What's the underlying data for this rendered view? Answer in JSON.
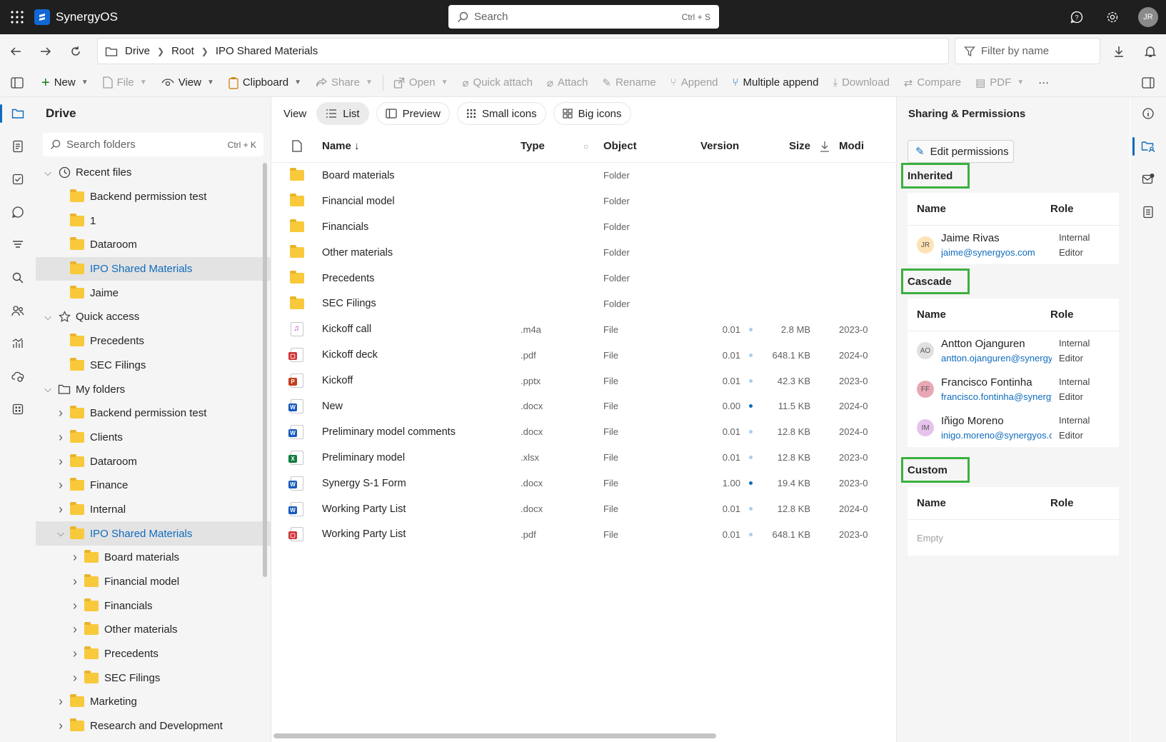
{
  "app": {
    "name": "SynergyOS",
    "user_initials": "JR"
  },
  "search": {
    "placeholder": "Search",
    "shortcut": "Ctrl + S"
  },
  "breadcrumb": [
    "Drive",
    "Root",
    "IPO Shared Materials"
  ],
  "filter": {
    "placeholder": "Filter by name"
  },
  "toolbar": {
    "new": "New",
    "file": "File",
    "view": "View",
    "clipboard": "Clipboard",
    "share": "Share",
    "open": "Open",
    "quick_attach": "Quick attach",
    "attach": "Attach",
    "rename": "Rename",
    "append": "Append",
    "multiple_append": "Multiple append",
    "download": "Download",
    "compare": "Compare",
    "pdf": "PDF",
    "more": "···"
  },
  "sidebar": {
    "title": "Drive",
    "search_placeholder": "Search folders",
    "search_shortcut": "Ctrl + K",
    "tree": [
      {
        "label": "Recent files",
        "level": 0,
        "kind": "clock",
        "expanded": true
      },
      {
        "label": "Backend permission test",
        "level": 1,
        "kind": "folder"
      },
      {
        "label": "1",
        "level": 1,
        "kind": "folder"
      },
      {
        "label": "Dataroom",
        "level": 1,
        "kind": "folder"
      },
      {
        "label": "IPO Shared Materials",
        "level": 1,
        "kind": "folder",
        "selected": true
      },
      {
        "label": "Jaime",
        "level": 1,
        "kind": "folder"
      },
      {
        "label": "Quick access",
        "level": 0,
        "kind": "star",
        "expanded": true
      },
      {
        "label": "Precedents",
        "level": 1,
        "kind": "folder"
      },
      {
        "label": "SEC Filings",
        "level": 1,
        "kind": "folder"
      },
      {
        "label": "My folders",
        "level": 0,
        "kind": "outline",
        "expanded": true
      },
      {
        "label": "Backend permission test",
        "level": 1,
        "kind": "folder",
        "chevron": "right"
      },
      {
        "label": "Clients",
        "level": 1,
        "kind": "folder",
        "chevron": "right"
      },
      {
        "label": "Dataroom",
        "level": 1,
        "kind": "folder",
        "chevron": "right"
      },
      {
        "label": "Finance",
        "level": 1,
        "kind": "folder",
        "chevron": "right"
      },
      {
        "label": "Internal",
        "level": 1,
        "kind": "folder",
        "chevron": "right"
      },
      {
        "label": "IPO Shared Materials",
        "level": 1,
        "kind": "folder",
        "chevron": "down",
        "selected": true
      },
      {
        "label": "Board materials",
        "level": 2,
        "kind": "folder",
        "chevron": "right"
      },
      {
        "label": "Financial model",
        "level": 2,
        "kind": "folder",
        "chevron": "right"
      },
      {
        "label": "Financials",
        "level": 2,
        "kind": "folder",
        "chevron": "right"
      },
      {
        "label": "Other materials",
        "level": 2,
        "kind": "folder",
        "chevron": "right"
      },
      {
        "label": "Precedents",
        "level": 2,
        "kind": "folder",
        "chevron": "right"
      },
      {
        "label": "SEC Filings",
        "level": 2,
        "kind": "folder",
        "chevron": "right"
      },
      {
        "label": "Marketing",
        "level": 1,
        "kind": "folder",
        "chevron": "right"
      },
      {
        "label": "Research and Development",
        "level": 1,
        "kind": "folder",
        "chevron": "right"
      }
    ]
  },
  "viewbar": {
    "label": "View",
    "list": "List",
    "preview": "Preview",
    "small_icons": "Small icons",
    "big_icons": "Big icons"
  },
  "table": {
    "headers": {
      "name": "Name ↓",
      "type": "Type",
      "object": "Object",
      "version": "Version",
      "size": "Size",
      "modified": "Modi"
    },
    "rows": [
      {
        "icon": "folder",
        "name": "Board materials",
        "type": "",
        "object": "Folder",
        "version": "",
        "size": "",
        "modified": ""
      },
      {
        "icon": "folder",
        "name": "Financial model",
        "type": "",
        "object": "Folder",
        "version": "",
        "size": "",
        "modified": ""
      },
      {
        "icon": "folder",
        "name": "Financials",
        "type": "",
        "object": "Folder",
        "version": "",
        "size": "",
        "modified": ""
      },
      {
        "icon": "folder",
        "name": "Other materials",
        "type": "",
        "object": "Folder",
        "version": "",
        "size": "",
        "modified": ""
      },
      {
        "icon": "folder",
        "name": "Precedents",
        "type": "",
        "object": "Folder",
        "version": "",
        "size": "",
        "modified": ""
      },
      {
        "icon": "folder",
        "name": "SEC Filings",
        "type": "",
        "object": "Folder",
        "version": "",
        "size": "",
        "modified": ""
      },
      {
        "icon": "audio",
        "name": "Kickoff call",
        "type": ".m4a",
        "object": "File",
        "version": "0.01",
        "dot": "light",
        "size": "2.8 MB",
        "modified": "2023-0"
      },
      {
        "icon": "pdf",
        "name": "Kickoff deck",
        "type": ".pdf",
        "object": "File",
        "version": "0.01",
        "dot": "light",
        "size": "648.1 KB",
        "modified": "2024-0"
      },
      {
        "icon": "pptx",
        "name": "Kickoff",
        "type": ".pptx",
        "object": "File",
        "version": "0.01",
        "dot": "light",
        "size": "42.3 KB",
        "modified": "2023-0"
      },
      {
        "icon": "docx",
        "name": "New",
        "type": ".docx",
        "object": "File",
        "version": "0.00",
        "dot": "dark",
        "size": "11.5 KB",
        "modified": "2024-0"
      },
      {
        "icon": "docx",
        "name": "Preliminary model comments",
        "type": ".docx",
        "object": "File",
        "version": "0.01",
        "dot": "light",
        "size": "12.8 KB",
        "modified": "2024-0"
      },
      {
        "icon": "xlsx",
        "name": "Preliminary model",
        "type": ".xlsx",
        "object": "File",
        "version": "0.01",
        "dot": "light",
        "size": "12.8 KB",
        "modified": "2023-0"
      },
      {
        "icon": "docx",
        "name": "Synergy S-1 Form",
        "type": ".docx",
        "object": "File",
        "version": "1.00",
        "dot": "dark",
        "size": "19.4 KB",
        "modified": "2023-0"
      },
      {
        "icon": "docx",
        "name": "Working Party List",
        "type": ".docx",
        "object": "File",
        "version": "0.01",
        "dot": "light",
        "size": "12.8 KB",
        "modified": "2024-0"
      },
      {
        "icon": "pdf",
        "name": "Working Party List",
        "type": ".pdf",
        "object": "File",
        "version": "0.01",
        "dot": "light",
        "size": "648.1 KB",
        "modified": "2023-0"
      }
    ]
  },
  "panel": {
    "title": "Sharing & Permissions",
    "edit_button": "Edit permissions",
    "col_name": "Name",
    "col_role": "Role",
    "inherited": {
      "label": "Inherited",
      "people": [
        {
          "initials": "JR",
          "avatar_color": "#fde2b5",
          "name": "Jaime Rivas",
          "email": "jaime@synergyos.com",
          "role1": "Internal",
          "role2": "Editor"
        }
      ]
    },
    "cascade": {
      "label": "Cascade",
      "people": [
        {
          "initials": "AO",
          "avatar_color": "#e0e0e0",
          "name": "Antton Ojanguren",
          "email": "antton.ojanguren@synergyos.com",
          "role1": "Internal",
          "role2": "Editor"
        },
        {
          "initials": "FF",
          "avatar_color": "#e9a7b5",
          "name": "Francisco Fontinha",
          "email": "francisco.fontinha@synergyos.com",
          "role1": "Internal",
          "role2": "Editor"
        },
        {
          "initials": "IM",
          "avatar_color": "#e6c3ec",
          "name": "Iñigo Moreno",
          "email": "inigo.moreno@synergyos.com",
          "role1": "Internal",
          "role2": "Editor"
        }
      ]
    },
    "custom": {
      "label": "Custom",
      "empty_text": "Empty"
    }
  },
  "colors": {
    "accent": "#0f6cbd",
    "folder": "#f8c93b",
    "highlight_box": "#3bb041"
  }
}
